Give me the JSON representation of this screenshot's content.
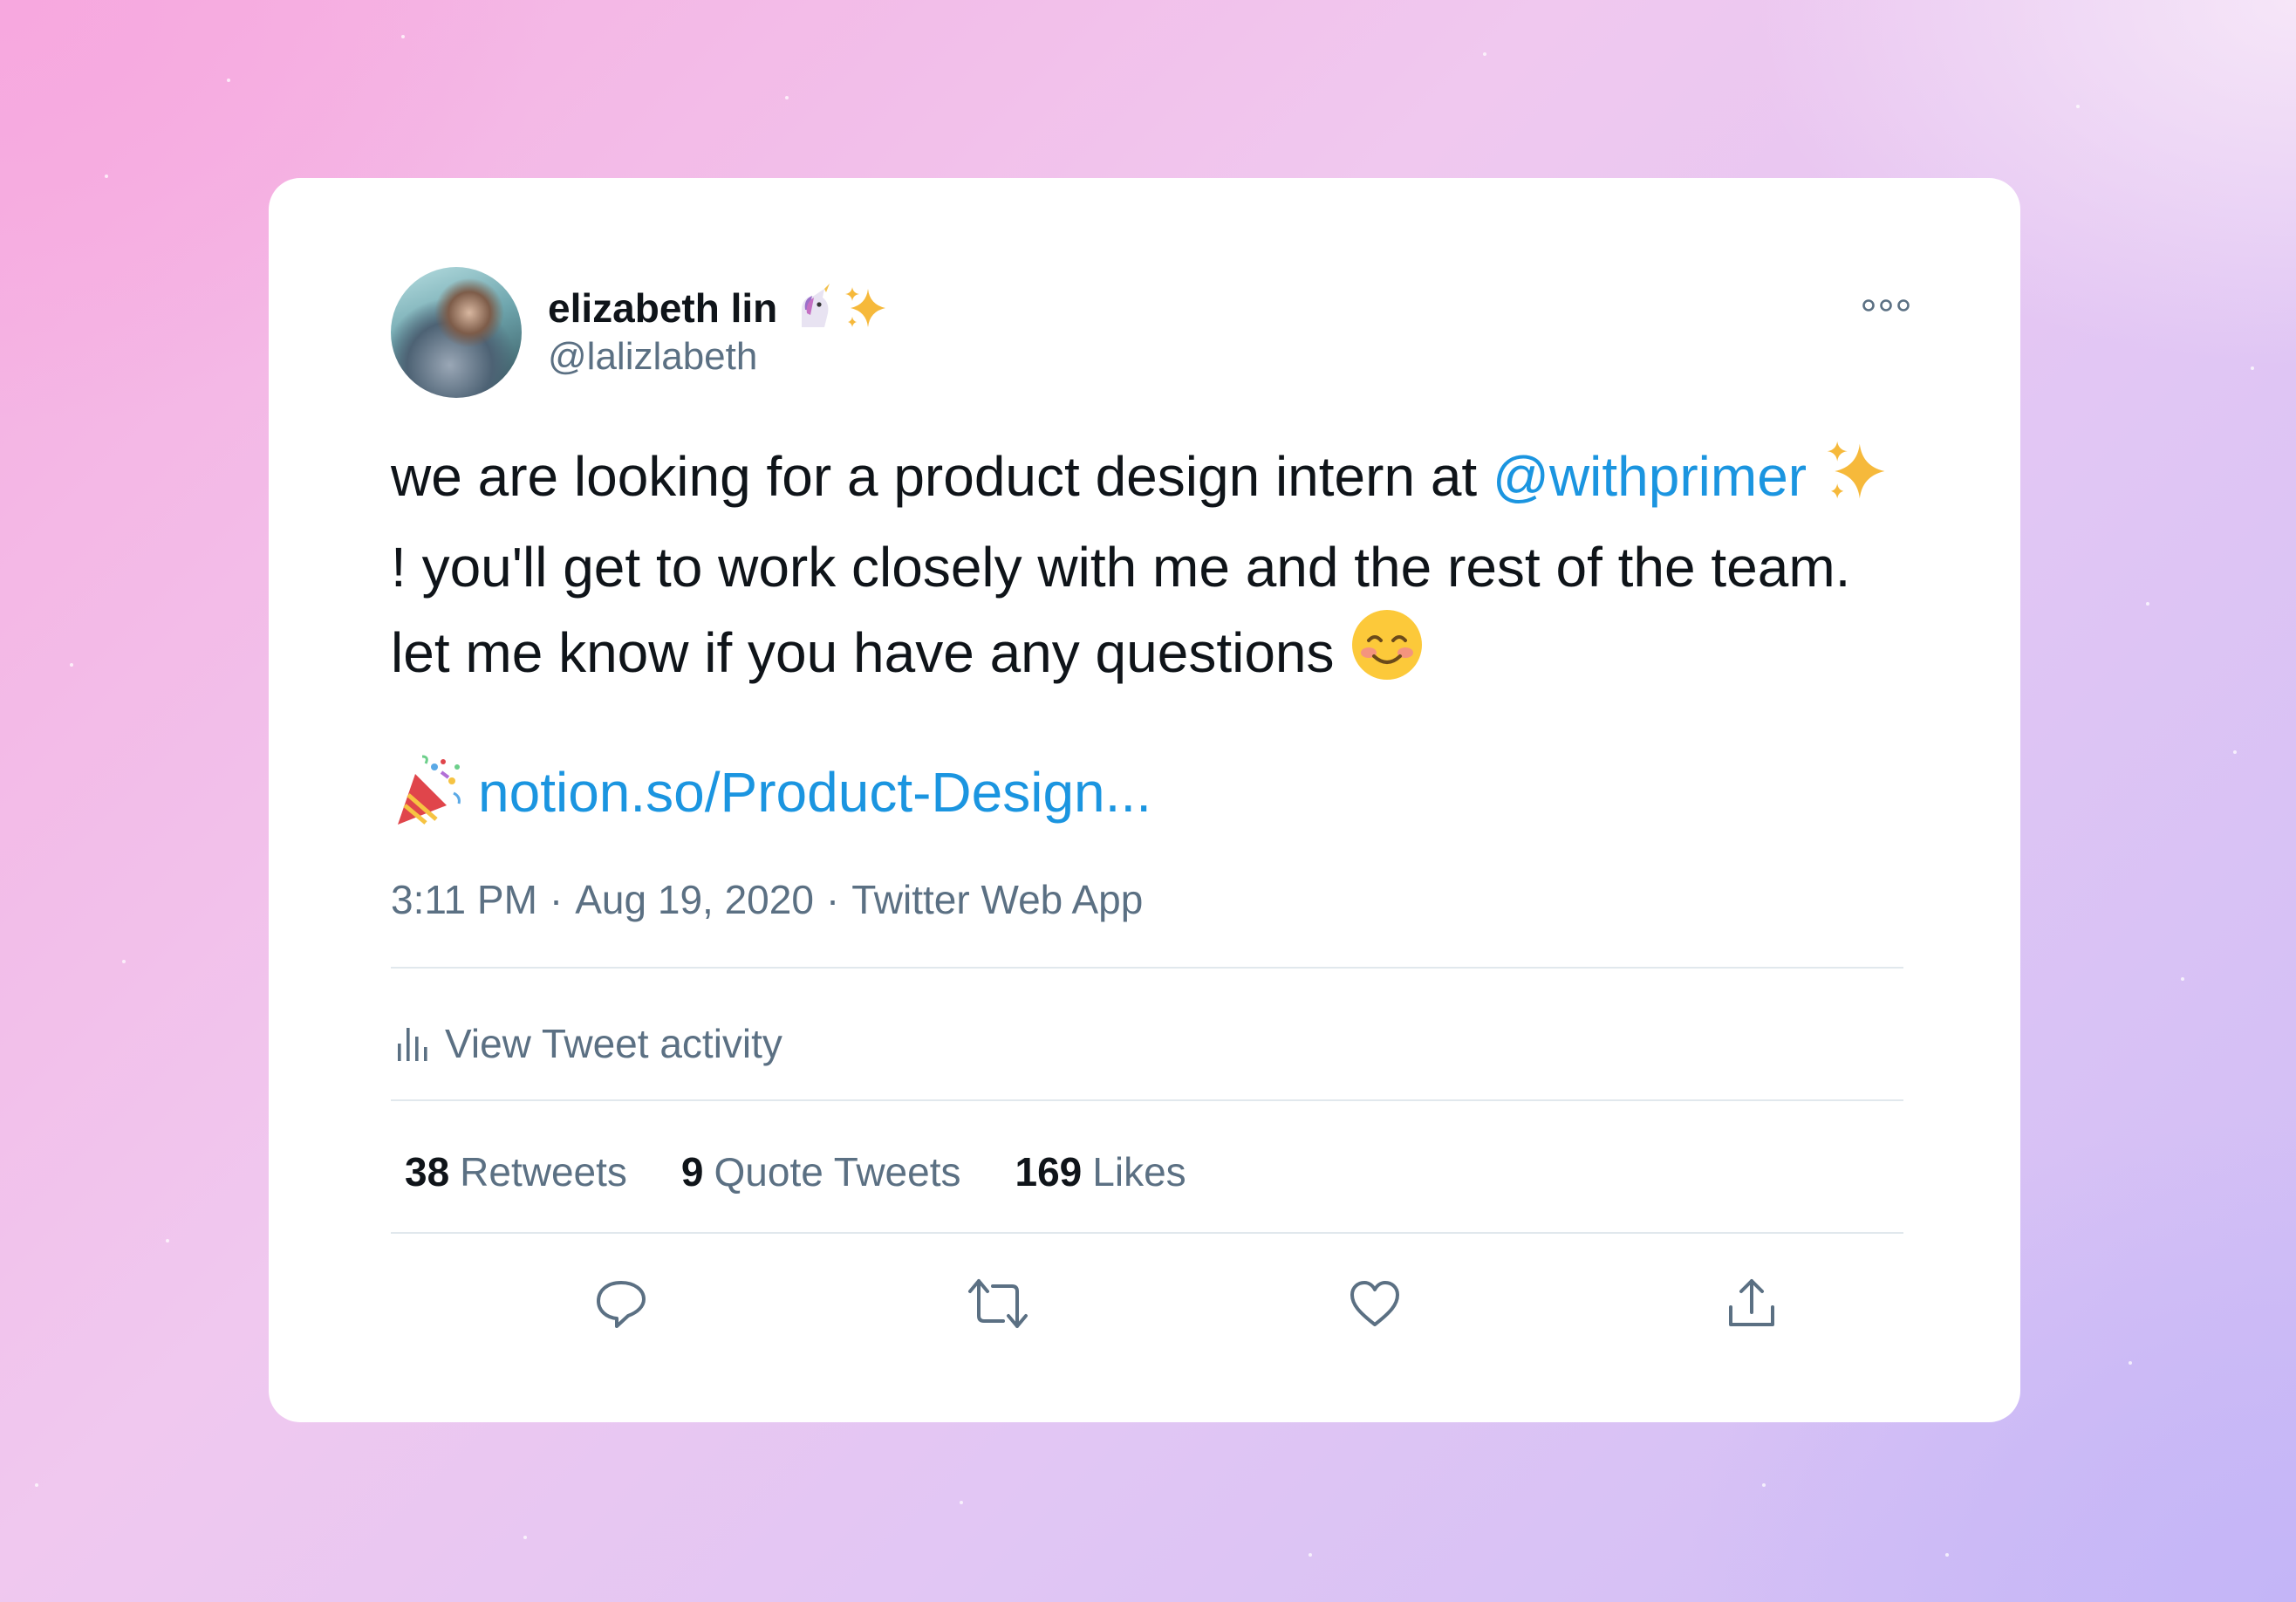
{
  "author": {
    "name": "elizabeth lin",
    "name_emojis": [
      "unicorn-emoji",
      "sparkles-emoji"
    ],
    "handle": "@lalizlabeth"
  },
  "tweet": {
    "text_part1": "we are looking for a product design intern at ",
    "mention": "@withprimer",
    "text_part2": "! you'll get to work closely with me and the rest of the team. let me know if you have any questions ",
    "link_text": "notion.so/Product-Design...",
    "time": "3:11 PM",
    "separator": "·",
    "date": "Aug 19, 2020",
    "source": "Twitter Web App"
  },
  "activity": {
    "label": "View Tweet activity"
  },
  "stats": {
    "retweets_count": "38",
    "retweets_label": "Retweets",
    "quotes_count": "9",
    "quotes_label": "Quote Tweets",
    "likes_count": "169",
    "likes_label": "Likes"
  },
  "colors": {
    "link": "#1b95e0",
    "text_primary": "#0f1419",
    "text_secondary": "#5b7083",
    "divider": "#e1e8ed"
  },
  "icons": [
    "more-icon",
    "bar-chart-icon",
    "reply-icon",
    "retweet-icon",
    "like-icon",
    "share-icon"
  ]
}
